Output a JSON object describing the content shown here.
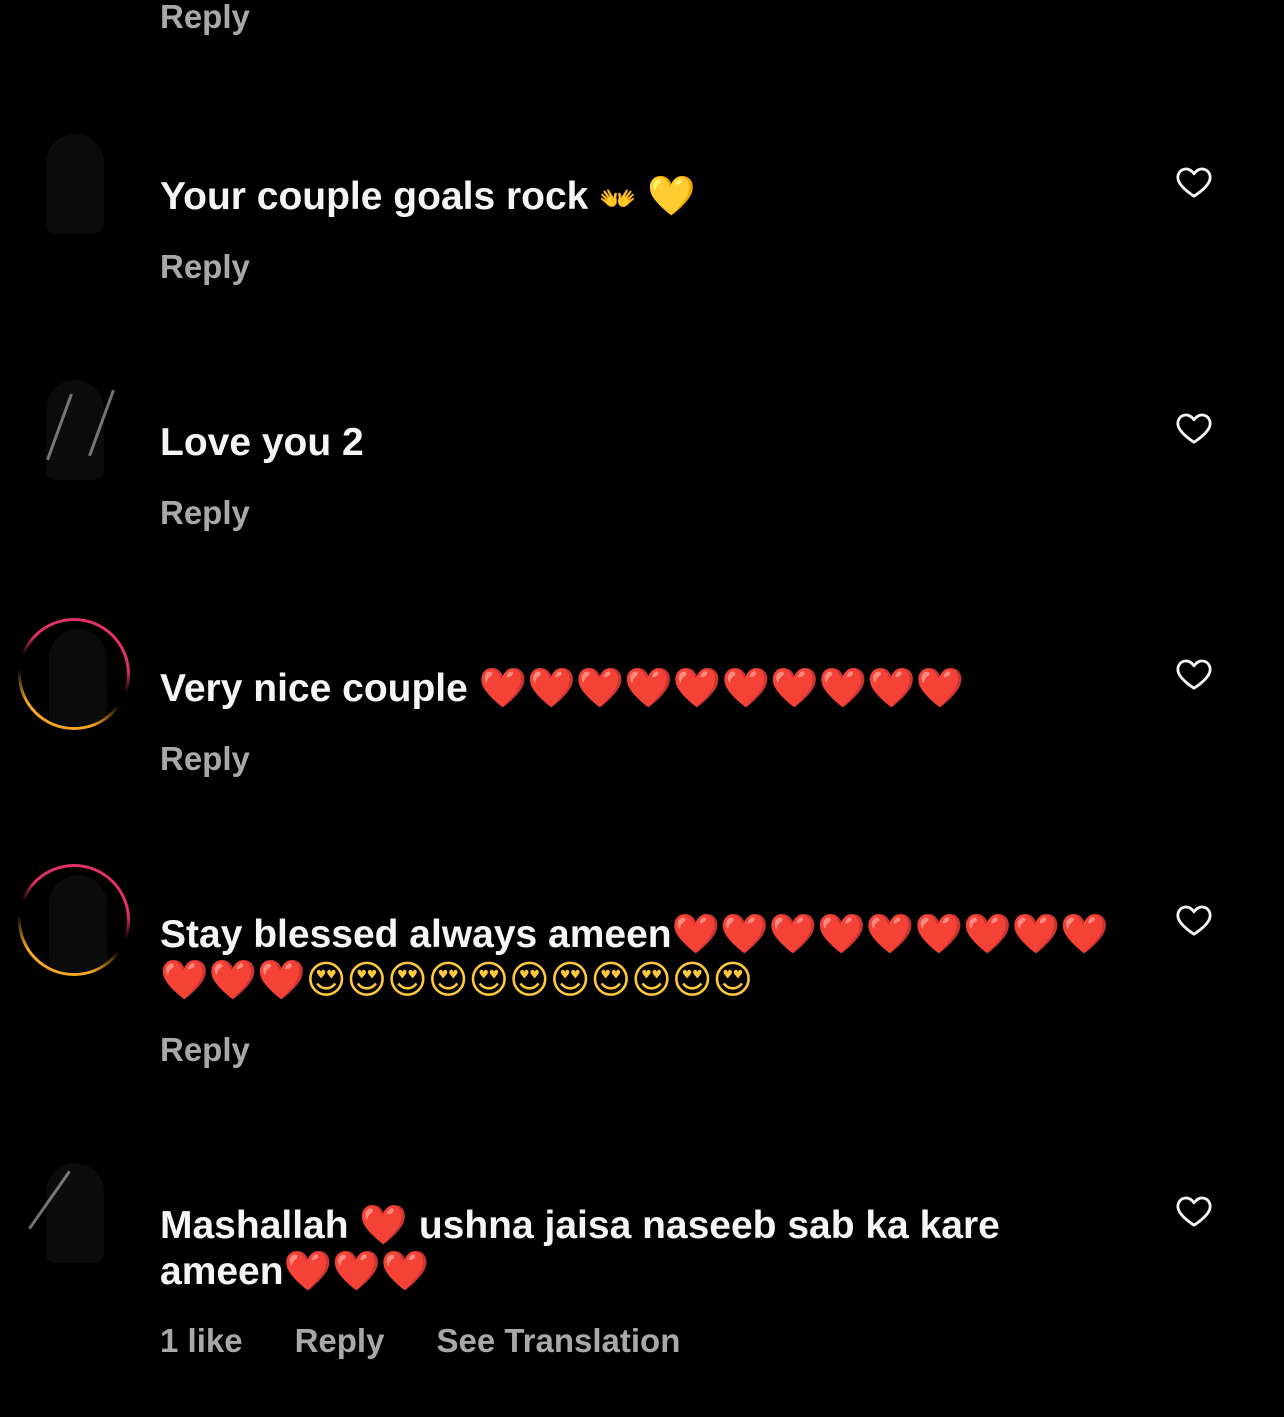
{
  "top": {
    "reply_label": "Reply"
  },
  "comments": [
    {
      "username": "",
      "text": "Your couple goals rock",
      "emojis": [
        "👐",
        "💛"
      ],
      "actions": [
        "Reply"
      ]
    },
    {
      "username": "",
      "text": "Love you 2",
      "emojis": [],
      "actions": [
        "Reply"
      ]
    },
    {
      "username": "",
      "text": "Very nice couple",
      "emojis": [
        "❤️",
        "❤️",
        "❤️",
        "❤️",
        "❤️",
        "❤️",
        "❤️",
        "❤️",
        "❤️",
        "❤️"
      ],
      "actions": [
        "Reply"
      ]
    },
    {
      "username": "",
      "text": "Stay blessed always ameen",
      "emojis": [
        "❤️",
        "❤️",
        "❤️",
        "❤️",
        "❤️",
        "❤️",
        "❤️",
        "❤️",
        "❤️",
        "❤️",
        "❤️",
        "❤️",
        "😍",
        "😍",
        "😍",
        "😍",
        "😍",
        "😍",
        "😍",
        "😍",
        "😍",
        "😍",
        "😍"
      ],
      "actions": [
        "Reply"
      ]
    },
    {
      "username": "",
      "text_part1": "Mashallah",
      "text_part2": "ushna jaisa naseeb sab ka kare ameen",
      "emojis_mid": [
        "❤️"
      ],
      "emojis_end": [
        "❤️",
        "❤️",
        "❤️"
      ],
      "actions": [
        "1 like",
        "Reply",
        "See Translation"
      ]
    }
  ],
  "icons": {
    "like": "heart-outline-icon",
    "heart_color": "#ff1a1a",
    "yellow_heart_color": "#ffcc1a",
    "action_text_color": "#a8a8a8"
  }
}
